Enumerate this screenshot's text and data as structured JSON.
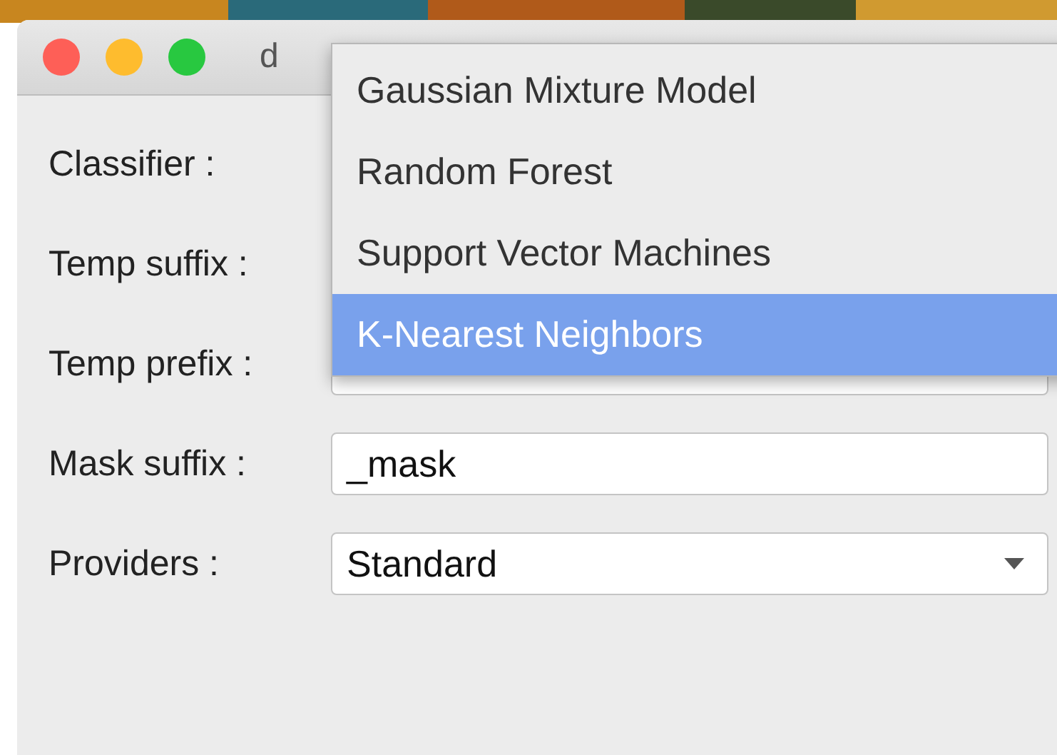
{
  "window": {
    "title": "d"
  },
  "form": [
    {
      "label": "Classifier :",
      "kind": "hidden"
    },
    {
      "label": "Temp suffix :",
      "kind": "hidden"
    },
    {
      "label": "Temp prefix :",
      "kind": "text"
    },
    {
      "label": "Mask suffix :",
      "kind": "text",
      "value": "_mask"
    },
    {
      "label": "Providers :",
      "kind": "combo",
      "value": "Standard"
    }
  ],
  "popup": {
    "items": [
      {
        "label": "Gaussian Mixture Model",
        "selected": false
      },
      {
        "label": "Random Forest",
        "selected": false
      },
      {
        "label": "Support Vector Machines",
        "selected": false
      },
      {
        "label": "K-Nearest Neighbors",
        "selected": true
      }
    ]
  }
}
